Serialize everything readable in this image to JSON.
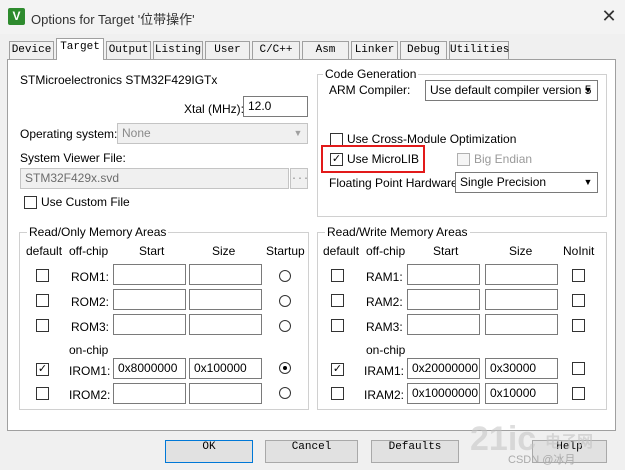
{
  "window": {
    "title": "Options for Target '位带操作'",
    "icon": "V",
    "close_glyph": "✕"
  },
  "tabs": [
    "Device",
    "Target",
    "Output",
    "Listing",
    "User",
    "C/C++",
    "Asm",
    "Linker",
    "Debug",
    "Utilities"
  ],
  "active_tab": "Target",
  "device": {
    "name": "STMicroelectronics STM32F429IGTx",
    "xtal_label": "Xtal (MHz):",
    "xtal_value": "12.0",
    "os_label": "Operating system:",
    "os_value": "None",
    "svf_label": "System Viewer File:",
    "svf_value": "STM32F429x.svd",
    "browse": "...",
    "custom_file_label": "Use Custom File"
  },
  "code_generation": {
    "legend": "Code Generation",
    "arm_compiler_label": "ARM Compiler:",
    "arm_compiler_value": "Use default compiler version 5",
    "cross_module_label": "Use Cross-Module Optimization",
    "microlib_label": "Use MicroLIB",
    "microlib_checked": true,
    "big_endian_label": "Big Endian",
    "fph_label": "Floating Point Hardware:",
    "fph_value": "Single Precision"
  },
  "ro_memory": {
    "legend": "Read/Only Memory Areas",
    "headers": {
      "default": "default",
      "offchip": "off-chip",
      "start": "Start",
      "size": "Size",
      "startup": "Startup"
    },
    "onchip_label": "on-chip",
    "rows": [
      {
        "label": "ROM1:",
        "start": "",
        "size": "",
        "default": false,
        "startup": false
      },
      {
        "label": "ROM2:",
        "start": "",
        "size": "",
        "default": false,
        "startup": false
      },
      {
        "label": "ROM3:",
        "start": "",
        "size": "",
        "default": false,
        "startup": false
      },
      {
        "label": "IROM1:",
        "start": "0x8000000",
        "size": "0x100000",
        "default": true,
        "startup": true
      },
      {
        "label": "IROM2:",
        "start": "",
        "size": "",
        "default": false,
        "startup": false
      }
    ]
  },
  "rw_memory": {
    "legend": "Read/Write Memory Areas",
    "headers": {
      "default": "default",
      "offchip": "off-chip",
      "start": "Start",
      "size": "Size",
      "noinit": "NoInit"
    },
    "onchip_label": "on-chip",
    "rows": [
      {
        "label": "RAM1:",
        "start": "",
        "size": "",
        "default": false,
        "noinit": false
      },
      {
        "label": "RAM2:",
        "start": "",
        "size": "",
        "default": false,
        "noinit": false
      },
      {
        "label": "RAM3:",
        "start": "",
        "size": "",
        "default": false,
        "noinit": false
      },
      {
        "label": "IRAM1:",
        "start": "0x20000000",
        "size": "0x30000",
        "default": true,
        "noinit": false
      },
      {
        "label": "IRAM2:",
        "start": "0x10000000",
        "size": "0x10000",
        "default": false,
        "noinit": false
      }
    ]
  },
  "buttons": {
    "ok": "OK",
    "cancel": "Cancel",
    "defaults": "Defaults",
    "help": "Help"
  },
  "watermark": {
    "logo": "21ic",
    "site": "电子网",
    "credit": "CSDN @冰月"
  },
  "colors": {
    "highlight": "#e21a1a",
    "focus": "#0078d7"
  }
}
